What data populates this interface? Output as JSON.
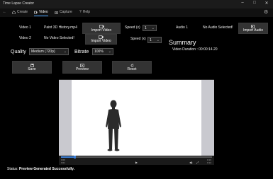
{
  "window": {
    "title": "Time Lapse Creator"
  },
  "nav": {
    "back": "←",
    "tabs": [
      {
        "label": "Create",
        "icon": "house-icon"
      },
      {
        "label": "Video",
        "icon": "video-icon"
      },
      {
        "label": "Capture",
        "icon": "camera-icon"
      },
      {
        "label": "Help",
        "icon": "question-icon"
      }
    ],
    "settings": "⚙"
  },
  "video1": {
    "label": "Video 1",
    "file": "Paint 3D History.mp4",
    "import": "Import Video",
    "speed_label": "Speed (x)",
    "speed_value": "1"
  },
  "video2": {
    "label": "Video 2",
    "file": "No Video Selected!",
    "import": "Import Video",
    "speed_label": "Speed (x)",
    "speed_value": "1"
  },
  "audio1": {
    "label": "Audio 1",
    "file": "No Audio Selected!",
    "import": "Import Audio"
  },
  "summary": {
    "title": "Summary",
    "duration": "Video Duration : 00:00:14.20"
  },
  "quality": {
    "label": "Quality",
    "value": "Medium (720p)"
  },
  "bitrate": {
    "label": "Bitrate",
    "value": "100%"
  },
  "actions": {
    "save": "Save",
    "preview": "Preview",
    "reset": "Reset"
  },
  "player": {
    "progress": 0.09,
    "time_left_top": "0:00",
    "time_left_bottom": "0:01",
    "time_right_top": "0:13",
    "time_right_bottom": "0:14"
  },
  "status": {
    "label": "Status:",
    "message": "Preview Generated Successfully."
  }
}
